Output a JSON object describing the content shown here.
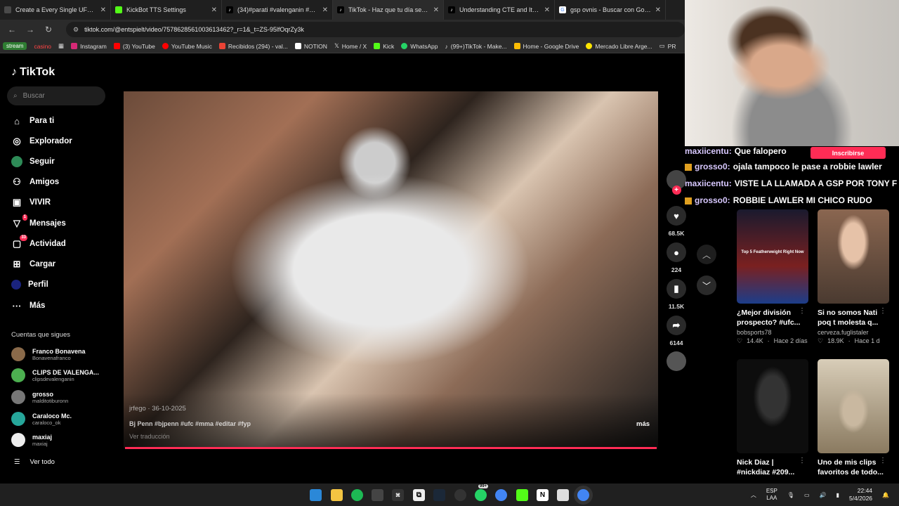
{
  "browser": {
    "tabs": [
      {
        "title": "Create a Every Single UFC Cham",
        "icon_color": "#4a4a4a"
      },
      {
        "title": "KickBot TTS Settings",
        "icon_color": "#53fc18"
      },
      {
        "title": "(34)#parati #valenganin #butta",
        "icon_color": "#000000"
      },
      {
        "title": "TikTok - Haz que tu día sea esp",
        "icon_color": "#000000"
      },
      {
        "title": "Understanding CTE and Its Imp",
        "icon_color": "#000000"
      },
      {
        "title": "gsp ovnis - Buscar con Google",
        "icon_color": "#4285f4"
      }
    ],
    "url": "tiktok.com/@entspielt/video/7578628561003613462?_r=1&_t=ZS-95lfOqrZy3k",
    "bookmarks": [
      {
        "label": "stream"
      },
      {
        "label": "casino"
      },
      {
        "label": "Instagram"
      },
      {
        "label": "(3) YouTube"
      },
      {
        "label": "YouTube Music"
      },
      {
        "label": "Recibidos (294) - val..."
      },
      {
        "label": "NOTION"
      },
      {
        "label": "Home / X"
      },
      {
        "label": "Kick"
      },
      {
        "label": "WhatsApp"
      },
      {
        "label": "(99+)TikTok - Make..."
      },
      {
        "label": "Home - Google Drive"
      },
      {
        "label": "Mercado Libre Arge..."
      },
      {
        "label": "PR"
      }
    ]
  },
  "tiktok": {
    "logo": "TikTok",
    "search_placeholder": "Buscar",
    "nav": [
      {
        "label": "Para ti",
        "icon": "home-icon",
        "badge": ""
      },
      {
        "label": "Explorador",
        "icon": "compass-icon",
        "badge": ""
      },
      {
        "label": "Seguir",
        "icon": "following-icon",
        "badge": ""
      },
      {
        "label": "Amigos",
        "icon": "friends-icon",
        "badge": ""
      },
      {
        "label": "VIVIR",
        "icon": "live-icon",
        "badge": ""
      },
      {
        "label": "Mensajes",
        "icon": "messages-icon",
        "badge": "1"
      },
      {
        "label": "Actividad",
        "icon": "activity-icon",
        "badge": "33"
      },
      {
        "label": "Cargar",
        "icon": "upload-icon",
        "badge": ""
      },
      {
        "label": "Perfil",
        "icon": "profile-icon",
        "badge": ""
      },
      {
        "label": "Más",
        "icon": "more-icon",
        "badge": ""
      }
    ],
    "following_title": "Cuentas que sigues",
    "following": [
      {
        "name": "Franco Bonavena",
        "handle": "Bonavenafranco",
        "color": "#8a6a4a"
      },
      {
        "name": "CLIPS DE VALENGA...",
        "handle": "clipsdevalenganin",
        "color": "#4caf50"
      },
      {
        "name": "grosso",
        "handle": "malditotiburonn",
        "color": "#777777"
      },
      {
        "name": "Caraloco Mc.",
        "handle": "caraloco_ok",
        "color": "#26a69a"
      },
      {
        "name": "maxiaj",
        "handle": "maxiaj",
        "color": "#eeeeee"
      }
    ],
    "see_all": "Ver todo",
    "video": {
      "author": "jrfego · 36-10-2025",
      "caption": "Bj Penn #bjpenn #ufc #mma #editar #fyp",
      "translation": "Ver traducción",
      "more": "más"
    },
    "actions": {
      "likes": "68.5K",
      "comments": "224",
      "saves": "11.5K",
      "shares": "6144"
    }
  },
  "stream": {
    "subscribe": "Inscribirse",
    "chat": [
      {
        "user": "maxiicentu:",
        "msg": "Que falopero",
        "mod": false
      },
      {
        "user": "grosso0:",
        "msg": "ojala tampoco le pase a robbie lawler",
        "mod": true
      },
      {
        "user": "maxiicentu:",
        "msg": "VISTE LA LLAMADA A GSP POR TONY F",
        "mod": false
      },
      {
        "user": "grosso0:",
        "msg": "ROBBIE LAWLER MI CHICO RUDO",
        "mod": true
      }
    ],
    "cards": [
      {
        "title": "¿Mejor división prospecto? #ufc...",
        "user": "bobsports78",
        "likes": "14.4K",
        "time": "Hace 2 días",
        "overlay": "Top 5 Featherweight Right Now",
        "bg": "#7a2020"
      },
      {
        "title": "Si no somos Nati poq t molesta q...",
        "user": "cerveza.fuglistaler",
        "likes": "18.9K",
        "time": "Hace 1 d",
        "overlay": "",
        "bg": "#9c7a68"
      },
      {
        "title": "Nick Diaz | #nickdiaz #209...",
        "user": "",
        "likes": "",
        "time": "",
        "overlay": "",
        "bg": "#111111"
      },
      {
        "title": "Uno de mis clips favoritos de todo...",
        "user": "",
        "likes": "",
        "time": "",
        "overlay": "",
        "bg": "#b9a890"
      }
    ]
  },
  "taskbar": {
    "lang": "ESP",
    "lang2": "LAA",
    "time": "22:44",
    "date": "5/4/2026",
    "whatsapp_badge": "99+"
  }
}
